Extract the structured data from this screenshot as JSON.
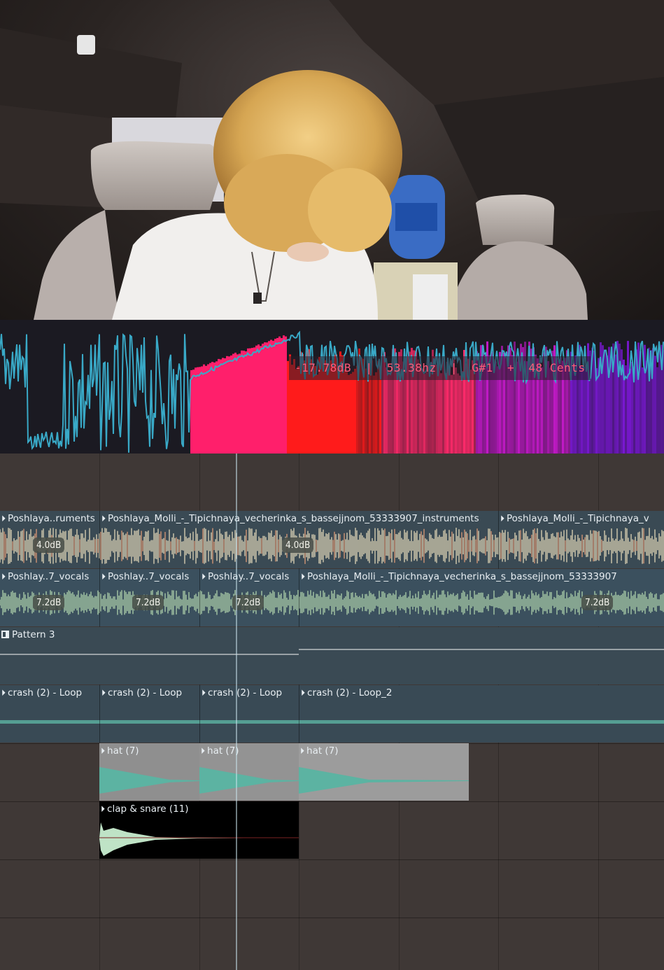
{
  "analyzer": {
    "readout": "-17.78dB  |  53.38hz  |  G#1  +  48 Cents"
  },
  "tracks": {
    "instruments": [
      {
        "label": "Poshlaya..ruments",
        "badge": "4.0dB"
      },
      {
        "label": "Poshlaya_Molli_-_Tipichnaya_vecherinka_s_bassejjnom_53333907_instruments",
        "badge": "4.0dB"
      },
      {
        "label": "Poshlaya_Molli_-_Tipichnaya_v",
        "badge": ""
      }
    ],
    "vocals": [
      {
        "label": "Poshlay..7_vocals",
        "badge": "7.2dB"
      },
      {
        "label": "Poshlay..7_vocals",
        "badge": "7.2dB"
      },
      {
        "label": "Poshlay..7_vocals",
        "badge": "7.2dB"
      },
      {
        "label": "Poshlaya_Molli_-_Tipichnaya_vecherinka_s_bassejjnom_53333907",
        "badge": "7.2dB"
      }
    ],
    "pattern": {
      "label": "Pattern 3"
    },
    "crash": [
      {
        "label": "crash (2) - Loop"
      },
      {
        "label": "crash (2) - Loop"
      },
      {
        "label": "crash (2) - Loop"
      },
      {
        "label": "crash (2) - Loop_2"
      }
    ],
    "hat": [
      {
        "label": "hat (7)"
      },
      {
        "label": "hat (7)"
      },
      {
        "label": "hat (7)"
      }
    ],
    "clap": {
      "label": "clap & snare (11)"
    }
  },
  "colors": {
    "playlist_bg": "#3f3836",
    "instrument_clip": "#3e4e58",
    "vocal_clip": "#3d5260",
    "crash_clip": "#394a55",
    "hat_clip": "#8e8e8e",
    "clap_clip": "#000000",
    "wave_cream": "#efe2c0",
    "wave_green": "#b7dcb2",
    "wave_teal": "#5cb3a2",
    "analyzer_line": "#39a9c7"
  }
}
